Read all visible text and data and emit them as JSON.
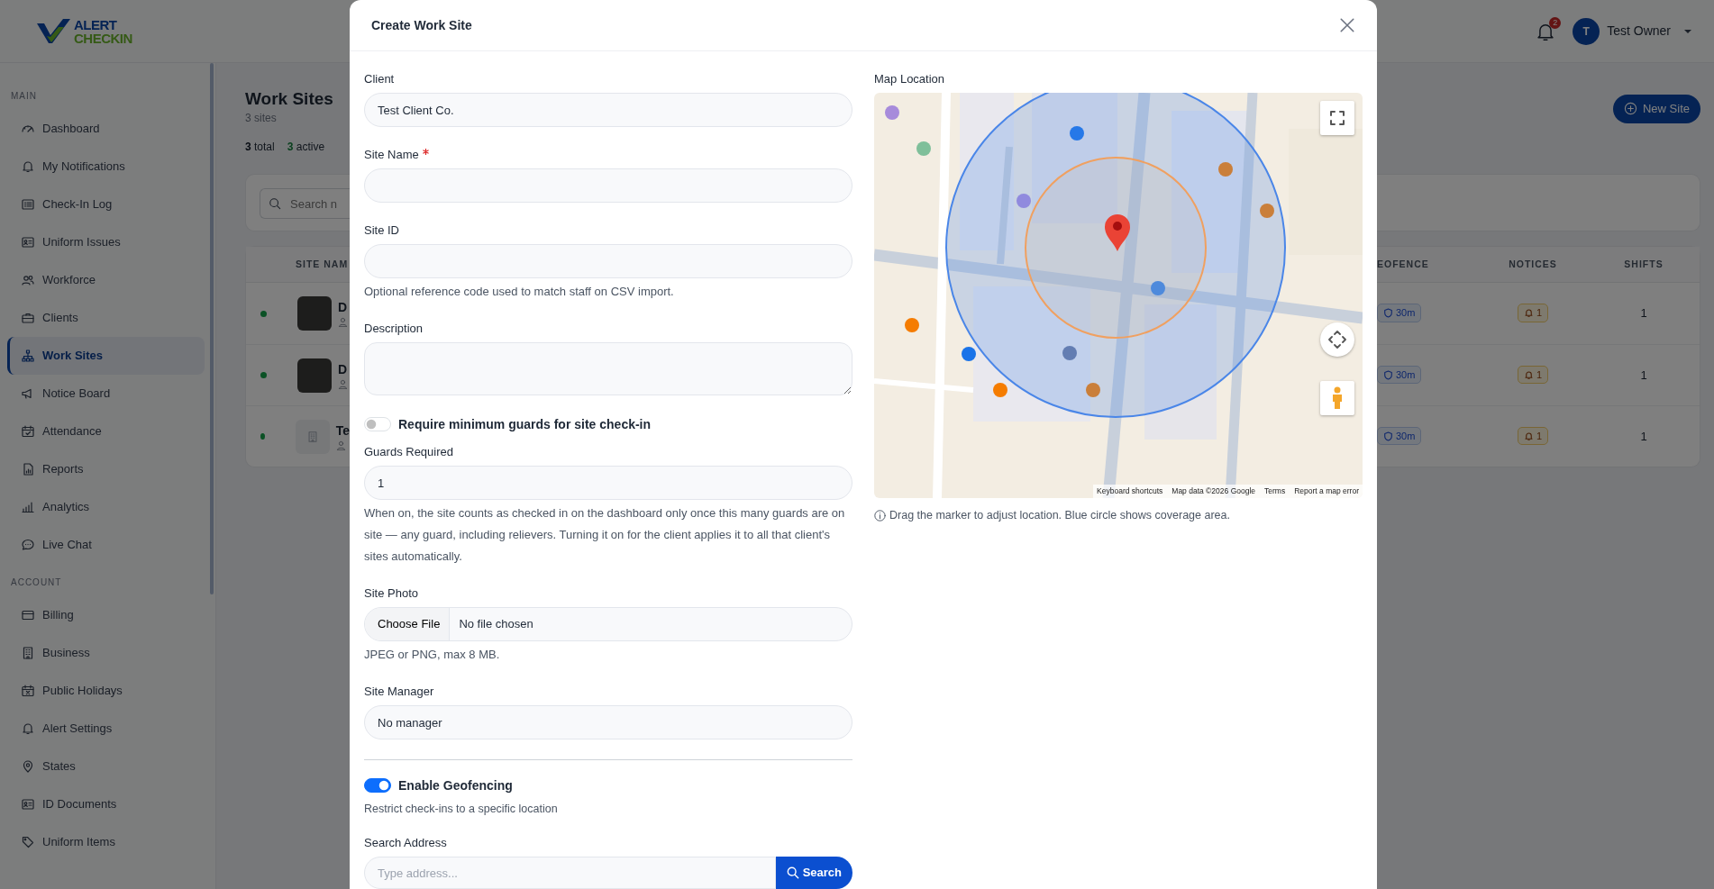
{
  "brand": {
    "line1": "ALERT",
    "line2": "CHECKIN"
  },
  "topbar": {
    "notification_count": "2",
    "user": {
      "initial": "T",
      "name": "Test Owner"
    }
  },
  "sidebar": {
    "sections": [
      {
        "title": "MAIN",
        "items": [
          {
            "label": "Dashboard",
            "selected": false
          },
          {
            "label": "My Notifications",
            "selected": false
          },
          {
            "label": "Check-In Log",
            "selected": false
          },
          {
            "label": "Uniform Issues",
            "selected": false
          },
          {
            "label": "Workforce",
            "selected": false
          },
          {
            "label": "Clients",
            "selected": false
          },
          {
            "label": "Work Sites",
            "selected": true
          },
          {
            "label": "Notice Board",
            "selected": false
          },
          {
            "label": "Attendance",
            "selected": false
          },
          {
            "label": "Reports",
            "selected": false
          },
          {
            "label": "Analytics",
            "selected": false
          },
          {
            "label": "Live Chat",
            "selected": false
          }
        ]
      },
      {
        "title": "ACCOUNT",
        "items": [
          {
            "label": "Billing",
            "selected": false
          },
          {
            "label": "Business",
            "selected": false
          },
          {
            "label": "Public Holidays",
            "selected": false
          },
          {
            "label": "Alert Settings",
            "selected": false
          },
          {
            "label": "States",
            "selected": false
          },
          {
            "label": "ID Documents",
            "selected": false
          },
          {
            "label": "Uniform Items",
            "selected": false
          }
        ]
      }
    ]
  },
  "page": {
    "title": "Work Sites",
    "subtitle": "3 sites",
    "stats": [
      {
        "kind": "total",
        "text": "**3** total"
      },
      {
        "kind": "active",
        "text": "**3** active"
      }
    ],
    "new_button": "New Site",
    "search": {
      "placeholder": "Search n"
    },
    "table": {
      "columns_left": [
        "SITE NAM"
      ],
      "columns_right": [
        "EOFENCE",
        "NOTICES",
        "SHIFTS"
      ],
      "rows": [
        {
          "active": true,
          "has_photo": true,
          "name": "D",
          "geofence": "30m",
          "notices": "1",
          "shifts": "1"
        },
        {
          "active": true,
          "has_photo": true,
          "name": "D",
          "geofence": "30m",
          "notices": "1",
          "shifts": "1"
        },
        {
          "active": true,
          "has_photo": false,
          "name": "Te",
          "geofence": "30m",
          "notices": "1",
          "shifts": "1"
        }
      ]
    }
  },
  "modal": {
    "title": "Create Work Site",
    "fields": [
      {
        "kind": "select",
        "label": "Client",
        "value": "Test Client Co.",
        "required": false
      },
      {
        "kind": "text",
        "label": "Site Name",
        "required": true
      },
      {
        "kind": "text",
        "label": "Site ID",
        "required": false,
        "help": "Optional reference code used to match staff on CSV import."
      },
      {
        "kind": "textarea",
        "label": "Description",
        "required": false
      },
      {
        "kind": "toggle",
        "label": "Require minimum guards for site check-in",
        "on": false
      },
      {
        "kind": "text",
        "label": "Guards Required",
        "value": "1",
        "required": false,
        "help": "When on, the site counts as checked in on the dashboard only once this many guards are on site — any guard, including relievers. Turning it on for the client applies it to all that client's sites automatically."
      },
      {
        "kind": "file",
        "label": "Site Photo",
        "button": "Choose File",
        "status": "No file chosen",
        "required": false,
        "help": "JPEG or PNG, max 8 MB."
      },
      {
        "kind": "select",
        "label": "Site Manager",
        "value": "No manager",
        "required": false
      },
      {
        "kind": "divider"
      },
      {
        "kind": "toggle",
        "label": "Enable Geofencing",
        "on": true,
        "help": "Restrict check-ins to a specific location"
      },
      {
        "kind": "search",
        "label": "Search Address",
        "placeholder": "Type address...",
        "button": "Search",
        "required": false
      }
    ],
    "map": {
      "label": "Map Location",
      "attribution": [
        "Keyboard shortcuts",
        "Map data ©2026 Google",
        "Terms",
        "Report a map error"
      ],
      "help": "Drag the marker to adjust location. Blue circle shows coverage area."
    }
  }
}
